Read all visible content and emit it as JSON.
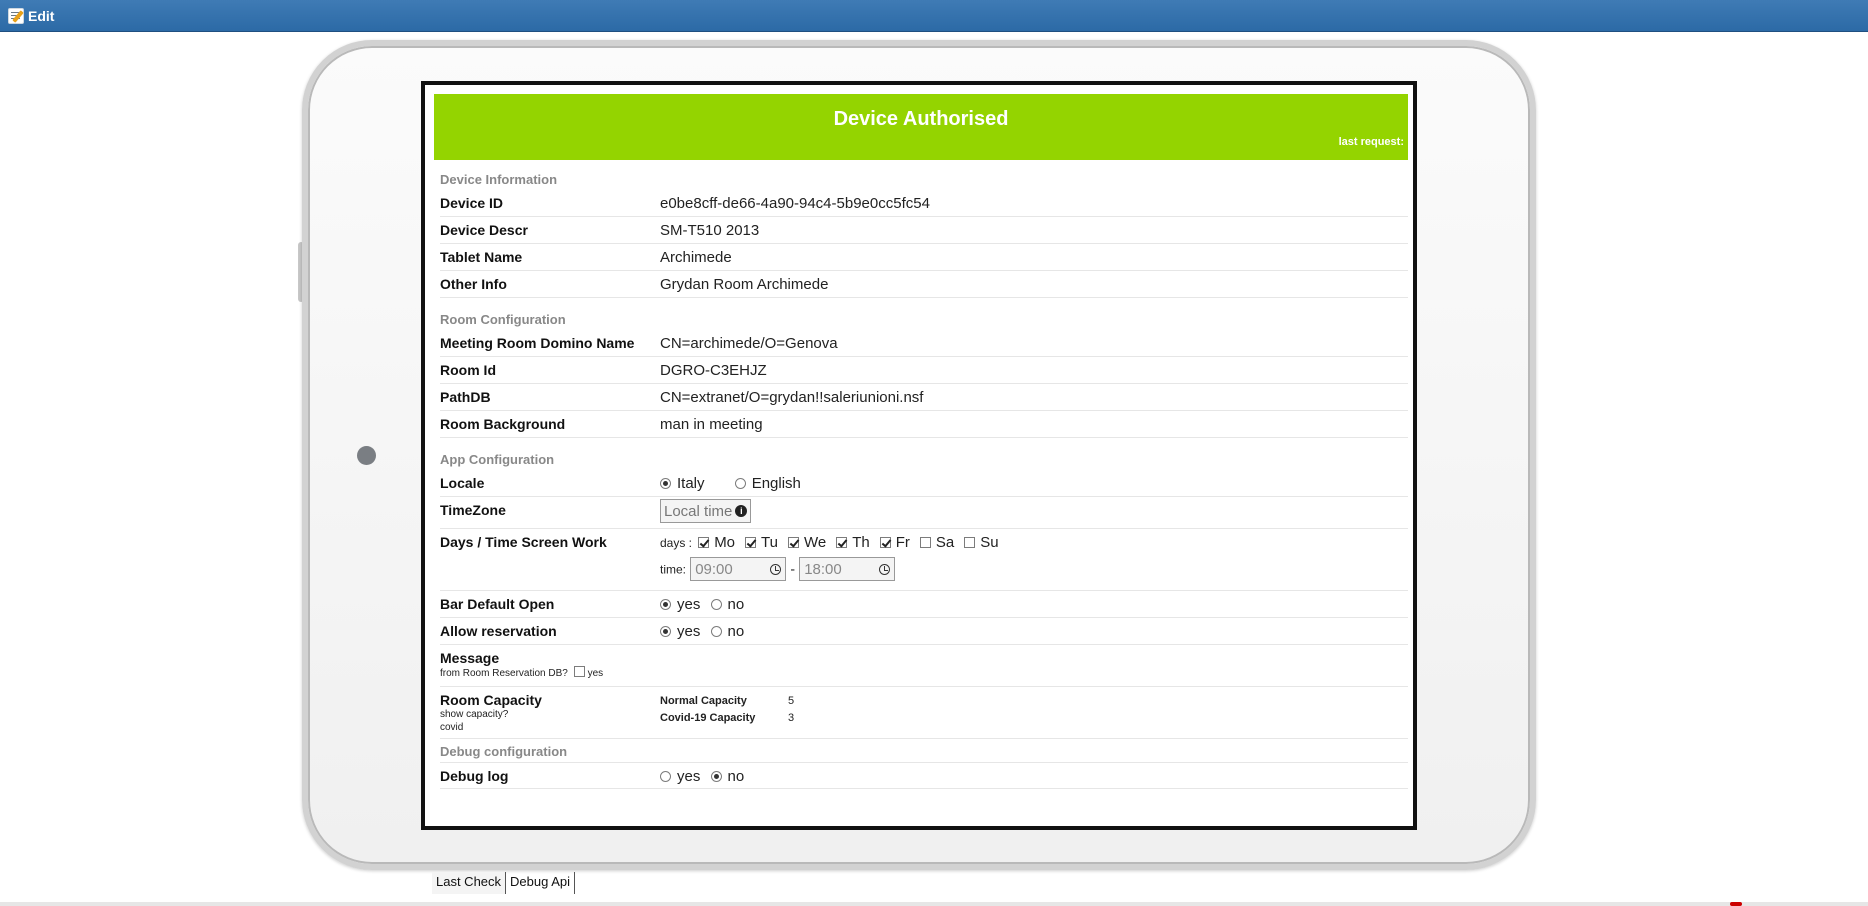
{
  "toolbar": {
    "edit_label": "Edit"
  },
  "header": {
    "title": "Device Authorised",
    "last_request": "last request:"
  },
  "device_info": {
    "section": "Device Information",
    "rows": [
      {
        "label": "Device ID",
        "value": "e0be8cff-de66-4a90-94c4-5b9e0cc5fc54"
      },
      {
        "label": "Device Descr",
        "value": "SM-T510 2013"
      },
      {
        "label": "Tablet Name",
        "value": "Archimede"
      },
      {
        "label": "Other Info",
        "value": "Grydan Room Archimede"
      }
    ]
  },
  "room_config": {
    "section": "Room Configuration",
    "rows": [
      {
        "label": "Meeting Room Domino Name",
        "value": "CN=archimede/O=Genova"
      },
      {
        "label": "Room Id",
        "value": "DGRO-C3EHJZ"
      },
      {
        "label": "PathDB",
        "value": "CN=extranet/O=grydan!!saleriunioni.nsf"
      },
      {
        "label": "Room Background",
        "value": "man in meeting"
      }
    ]
  },
  "app_config": {
    "section": "App Configuration",
    "locale": {
      "label": "Locale",
      "options": [
        "Italy",
        "English"
      ],
      "selected": "Italy"
    },
    "timezone": {
      "label": "TimeZone",
      "value": "Local time"
    },
    "days_time": {
      "label": "Days / Time Screen Work",
      "days_prefix": "days :",
      "days": [
        {
          "name": "Mo",
          "checked": true
        },
        {
          "name": "Tu",
          "checked": true
        },
        {
          "name": "We",
          "checked": true
        },
        {
          "name": "Th",
          "checked": true
        },
        {
          "name": "Fr",
          "checked": true
        },
        {
          "name": "Sa",
          "checked": false
        },
        {
          "name": "Su",
          "checked": false
        }
      ],
      "time_prefix": "time:",
      "start": "09:00",
      "separator": "-",
      "end": "18:00"
    },
    "bar_default_open": {
      "label": "Bar Default Open",
      "yes": "yes",
      "no": "no",
      "selected": "yes"
    },
    "allow_reservation": {
      "label": "Allow reservation",
      "yes": "yes",
      "no": "no",
      "selected": "yes"
    },
    "message": {
      "label": "Message",
      "sub": "from Room Reservation DB?",
      "check_label": "yes",
      "checked": false
    },
    "capacity": {
      "label": "Room Capacity",
      "sub1": "show capacity?",
      "sub2": "covid",
      "normal_label": "Normal Capacity",
      "normal_value": "5",
      "covid_label": "Covid-19 Capacity",
      "covid_value": "3"
    }
  },
  "debug_config": {
    "section": "Debug configuration",
    "debug_log": {
      "label": "Debug log",
      "yes": "yes",
      "no": "no",
      "selected": "no"
    }
  },
  "tabs": [
    "Last Check",
    "Debug Api"
  ],
  "colors": {
    "topbar": "#2c6aa6",
    "header_green": "#94d400"
  }
}
